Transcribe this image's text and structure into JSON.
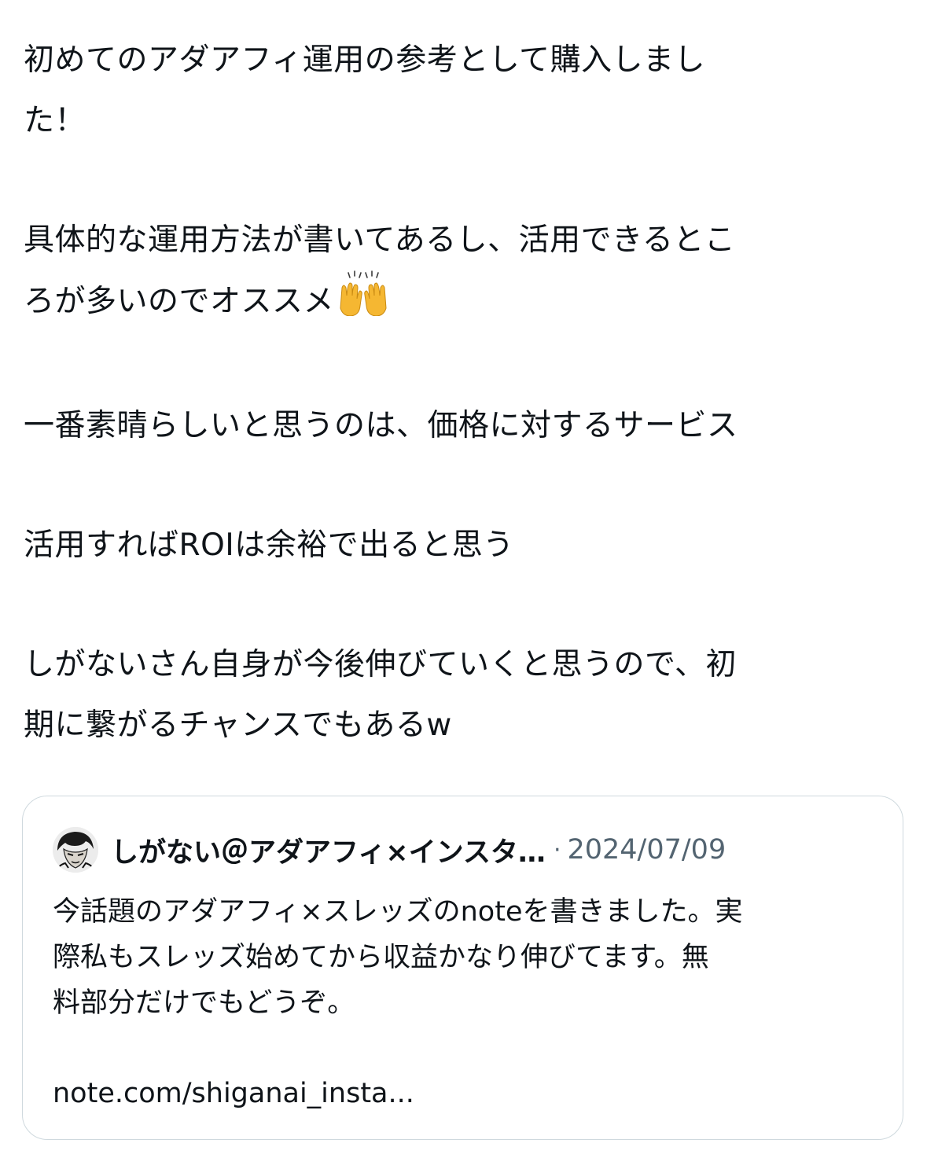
{
  "post": {
    "paragraphs": [
      "初めてのアダアフィ運用の参考として購入しまし\nた！",
      "具体的な運用方法が書いてあるし、活用できるとこ\nろが多いのでオススメ",
      "一番素晴らしいと思うのは、価格に対するサービス",
      "活用すればROIは余裕で出ると思う",
      "しがないさん自身が今後伸びていくと思うので、初\n期に繋がるチャンスでもあるw"
    ],
    "emoji": "raised-hands-emoji"
  },
  "quote": {
    "author": "しがない＠アダアフィ×インスタ…",
    "separator": "·",
    "date": "2024/07/09",
    "body": "今話題のアダアフィ×スレッズのnoteを書きました。実\n際私もスレッズ始めてから収益かなり伸びてます。無\n料部分だけでもどうぞ。",
    "link": "note.com/shiganai_insta..."
  },
  "colors": {
    "text": "#0f1419",
    "muted": "#536471",
    "border": "#cfd9de",
    "emoji_fill": "#f5b732"
  }
}
